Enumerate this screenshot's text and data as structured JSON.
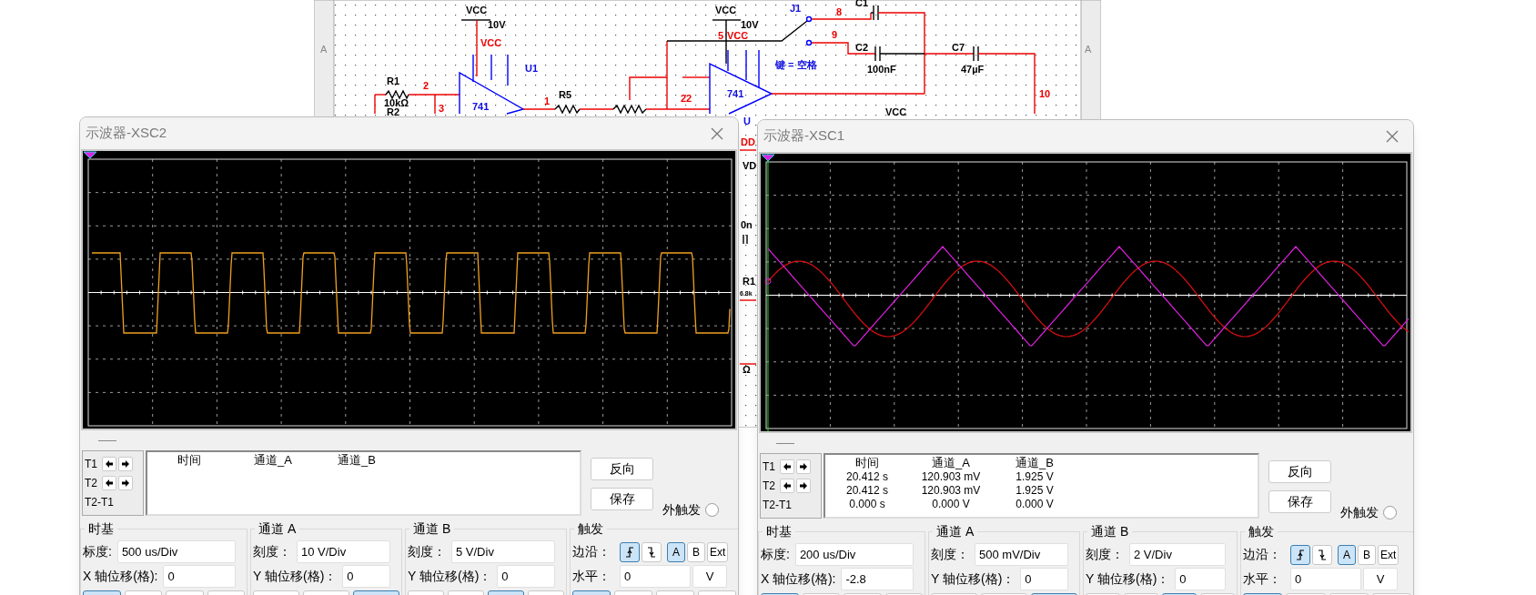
{
  "schematic": {
    "labels": [
      {
        "text": "VCC",
        "kind": "label"
      },
      {
        "text": "10V",
        "kind": "label"
      },
      {
        "text": "VCC",
        "kind": "net"
      },
      {
        "text": "U1",
        "kind": "ref"
      },
      {
        "text": "R1",
        "kind": "label"
      },
      {
        "text": "10kΩ",
        "kind": "label"
      },
      {
        "text": "R2",
        "kind": "label"
      },
      {
        "text": "2",
        "kind": "net"
      },
      {
        "text": "3",
        "kind": "net"
      },
      {
        "text": "741",
        "kind": "ref"
      },
      {
        "text": "1",
        "kind": "net"
      },
      {
        "text": "R5",
        "kind": "label"
      },
      {
        "text": "VCC",
        "kind": "label"
      },
      {
        "text": "10V",
        "kind": "label"
      },
      {
        "text": "5",
        "kind": "net"
      },
      {
        "text": "VCC",
        "kind": "net"
      },
      {
        "text": "J1",
        "kind": "ref"
      },
      {
        "text": "8",
        "kind": "net"
      },
      {
        "text": "C1",
        "kind": "label"
      },
      {
        "text": "9",
        "kind": "net"
      },
      {
        "text": "C2",
        "kind": "label"
      },
      {
        "text": "100nF",
        "kind": "label"
      },
      {
        "text": "C7",
        "kind": "label"
      },
      {
        "text": "47µF",
        "kind": "label"
      },
      {
        "text": "键 = 空格",
        "kind": "ref"
      },
      {
        "text": "741",
        "kind": "ref"
      },
      {
        "text": "22",
        "kind": "net"
      },
      {
        "text": "10",
        "kind": "net"
      },
      {
        "text": "VCC",
        "kind": "label"
      },
      {
        "text": "A",
        "kind": "margin"
      },
      {
        "text": "A",
        "kind": "margin"
      },
      {
        "text": "U",
        "kind": "ref"
      },
      {
        "text": "DD",
        "kind": "net"
      },
      {
        "text": "VD",
        "kind": "label"
      },
      {
        "text": "0n",
        "kind": "label"
      },
      {
        "text": "R1",
        "kind": "label"
      },
      {
        "text": "6.8k",
        "kind": "label"
      },
      {
        "text": "Ω",
        "kind": "label"
      }
    ]
  },
  "scopes": [
    {
      "title": "示波器-XSC2",
      "kind": "square",
      "cursor_labels": [
        "T1",
        "T2",
        "T2-T1"
      ],
      "readout": {
        "columns": [
          "时间",
          "通道_A",
          "通道_B"
        ]
      },
      "buttons": [
        "反向",
        "保存"
      ],
      "ext_trigger": "外触发",
      "ext_trigger_checked": false,
      "timebase": {
        "title": "时基",
        "rows": [
          {
            "label": "标度:",
            "value": "500 us/Div"
          },
          {
            "label": "X 轴位移(格):",
            "value": "0"
          }
        ],
        "modes": [
          {
            "selected": true
          },
          {
            "selected": false
          },
          {
            "selected": false
          },
          {
            "selected": false
          }
        ]
      },
      "channels": [
        {
          "title": "通道 A",
          "rows": [
            {
              "label": "刻度：",
              "value": "10  V/Div"
            },
            {
              "label": "Y 轴位移(格)：",
              "value": "0"
            }
          ],
          "modes": [
            {
              "selected": false
            },
            {
              "selected": false
            },
            {
              "selected": true
            }
          ]
        },
        {
          "title": "通道 B",
          "rows": [
            {
              "label": "刻度：",
              "value": "5  V/Div"
            },
            {
              "label": "Y 轴位移(格)：",
              "value": "0"
            }
          ],
          "modes": [
            {
              "selected": false
            },
            {
              "selected": false
            },
            {
              "selected": true
            },
            {
              "selected": false
            }
          ]
        }
      ],
      "trigger": {
        "title": "触发",
        "edge_label": "边沿：",
        "edges": [
          {
            "kind": "rising",
            "selected": true
          },
          {
            "kind": "falling",
            "selected": false
          }
        ],
        "sources": [
          {
            "label": "A",
            "selected": true
          },
          {
            "label": "B",
            "selected": false
          },
          {
            "label": "Ext",
            "selected": false
          }
        ],
        "level_label": "水平：",
        "level": "0",
        "unit": "V",
        "modes": [
          {
            "selected": true
          },
          {
            "selected": false
          },
          {
            "selected": false
          },
          {
            "selected": false
          }
        ]
      }
    },
    {
      "title": "示波器-XSC1",
      "kind": "dual",
      "cursor_labels": [
        "T1",
        "T2",
        "T2-T1"
      ],
      "readout": {
        "columns": [
          "时间",
          "通道_A",
          "通道_B"
        ],
        "rows": [
          [
            "20.412 s",
            "120.903 mV",
            "1.925 V"
          ],
          [
            "20.412 s",
            "120.903 mV",
            "1.925 V"
          ],
          [
            "0.000 s",
            "0.000 V",
            "0.000 V"
          ]
        ]
      },
      "buttons": [
        "反向",
        "保存"
      ],
      "ext_trigger": "外触发",
      "ext_trigger_checked": false,
      "timebase": {
        "title": "时基",
        "rows": [
          {
            "label": "标度:",
            "value": "200 us/Div"
          },
          {
            "label": "X 轴位移(格):",
            "value": "-2.8"
          }
        ],
        "modes": [
          {
            "selected": true
          },
          {
            "selected": false
          },
          {
            "selected": false
          },
          {
            "selected": false
          }
        ]
      },
      "channels": [
        {
          "title": "通道 A",
          "rows": [
            {
              "label": "刻度：",
              "value": "500 mV/Div"
            },
            {
              "label": "Y 轴位移(格)：",
              "value": "0"
            }
          ],
          "modes": [
            {
              "selected": false
            },
            {
              "selected": false
            },
            {
              "selected": true
            }
          ]
        },
        {
          "title": "通道 B",
          "rows": [
            {
              "label": "刻度：",
              "value": "2  V/Div"
            },
            {
              "label": "Y 轴位移(格)：",
              "value": "0"
            }
          ],
          "modes": [
            {
              "selected": false
            },
            {
              "selected": false
            },
            {
              "selected": true
            },
            {
              "selected": false
            }
          ]
        }
      ],
      "trigger": {
        "title": "触发",
        "edge_label": "边沿：",
        "edges": [
          {
            "kind": "rising",
            "selected": true
          },
          {
            "kind": "falling",
            "selected": false
          }
        ],
        "sources": [
          {
            "label": "A",
            "selected": true
          },
          {
            "label": "B",
            "selected": false
          },
          {
            "label": "Ext",
            "selected": false
          }
        ],
        "level_label": "水平：",
        "level": "0",
        "unit": "V",
        "modes": [
          {
            "selected": true
          },
          {
            "selected": false
          },
          {
            "selected": false
          },
          {
            "selected": false
          }
        ]
      }
    }
  ]
}
